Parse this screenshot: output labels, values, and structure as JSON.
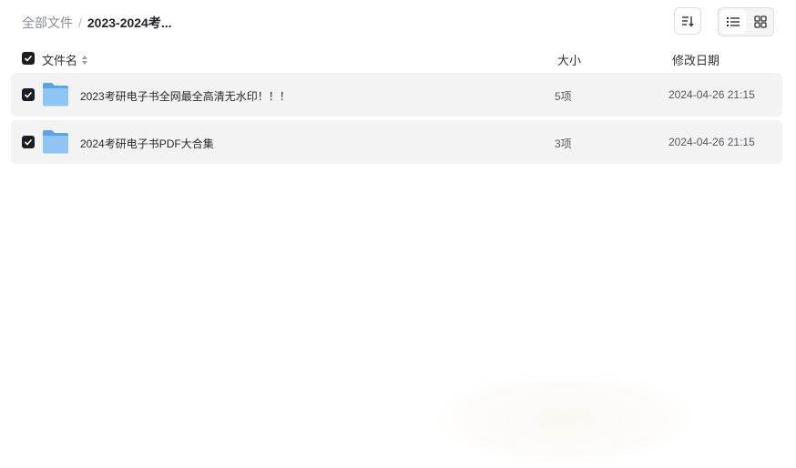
{
  "breadcrumb": {
    "root": "全部文件",
    "separator": "/",
    "current": "2023-2024考..."
  },
  "toolbar": {
    "sort_icon": "sort-icon",
    "view_list_icon": "list-view-icon",
    "view_grid_icon": "grid-view-icon"
  },
  "columns": {
    "name": "文件名",
    "size": "大小",
    "date": "修改日期"
  },
  "files": [
    {
      "name": "2023考研电子书全网最全高清无水印！！！",
      "size": "5项",
      "date": "2024-04-26 21:15",
      "checked": true
    },
    {
      "name": "2024考研电子书PDF大合集",
      "size": "3项",
      "date": "2024-04-26 21:15",
      "checked": true
    }
  ],
  "colors": {
    "row_bg": "#f3f3f4",
    "checkbox": "#1d1e22",
    "folder": "#7ab8f0"
  }
}
